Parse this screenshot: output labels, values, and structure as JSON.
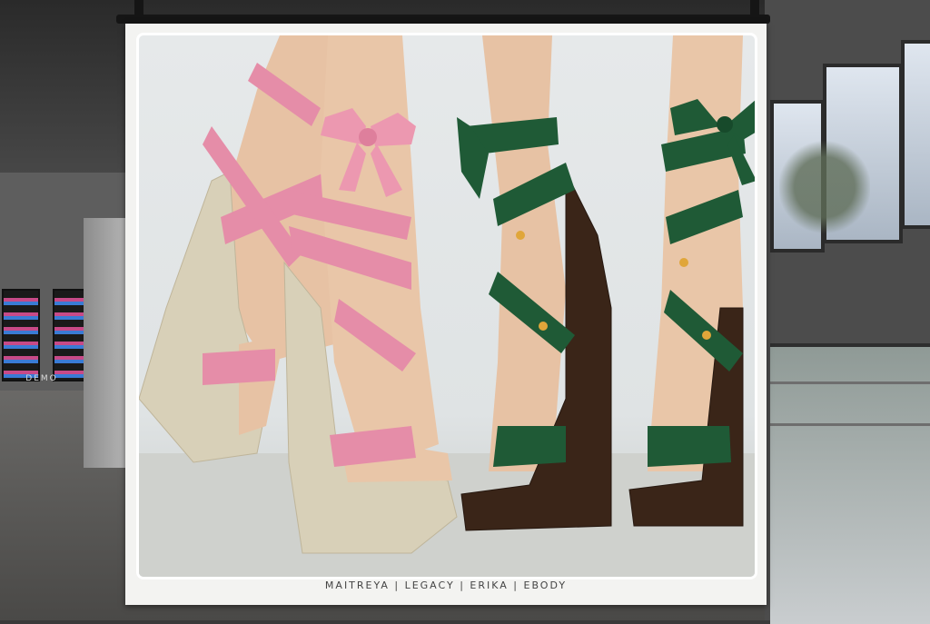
{
  "background": {
    "store_sign": "DEMO"
  },
  "poster": {
    "caption": "MAITREYA | LEGACY | ERIKA | EBODY"
  },
  "colors": {
    "pink_strap": "#e58da8",
    "pink_bow": "#ec98b0",
    "green_strap": "#1f5a36",
    "wedge_cream": "#d8d0b8",
    "wedge_dark": "#3a2518",
    "skin": "#e7c2a4"
  }
}
